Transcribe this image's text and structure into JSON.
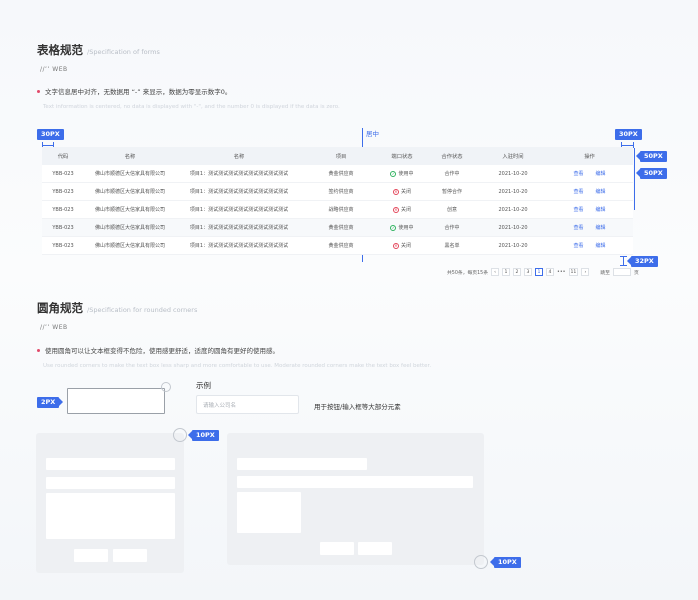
{
  "table_section": {
    "title": "表格规范",
    "subtitle": "/Specification of forms",
    "tag": "//’’  WEB",
    "rule_cn": "文字信息居中对齐，无数据用 “-” 来显示，数据为零显示数字0。",
    "rule_en": "Text information is centered, no data is displayed with \"-\", and the number 0 is displayed if the data is zero.",
    "center_label": "居中",
    "badges": {
      "left_margin": "30PX",
      "right_margin": "30PX",
      "row_height_1": "50PX",
      "row_height_2": "50PX",
      "bottom_gap": "32PX"
    },
    "columns": [
      "代码",
      "名称",
      "名称",
      "项目",
      "端口状态",
      "合作状态",
      "入驻时间",
      "操作"
    ],
    "rows": [
      {
        "code": "YBB-023",
        "company": "佛山市顺德区大信家具有限公司",
        "desc": "项目1：测试测试测试测试测试测试测试测试",
        "project": "黄金供应商",
        "status": "使用中",
        "coop": "合作中",
        "date": "2021-10-20",
        "op1": "查看",
        "op2": "编辑"
      },
      {
        "code": "YBB-023",
        "company": "佛山市顺德区大信家具有限公司",
        "desc": "项目1：测试测试测试测试测试测试测试测试",
        "project": "签约供应商",
        "status": "关闭",
        "coop": "暂停合作",
        "date": "2021-10-20",
        "op1": "查看",
        "op2": "编辑"
      },
      {
        "code": "YBB-023",
        "company": "佛山市顺德区大信家具有限公司",
        "desc": "项目1：测试测试测试测试测试测试测试测试",
        "project": "战略供应商",
        "status": "关闭",
        "coop": "创意",
        "date": "2021-10-20",
        "op1": "查看",
        "op2": "编辑"
      },
      {
        "code": "YBB-023",
        "company": "佛山市顺德区大信家具有限公司",
        "desc": "项目1：测试测试测试测试测试测试测试测试",
        "project": "黄金供应商",
        "status": "使用中",
        "coop": "合作中",
        "date": "2021-10-20",
        "op1": "查看",
        "op2": "编辑"
      },
      {
        "code": "YBB-023",
        "company": "佛山市顺德区大信家具有限公司",
        "desc": "项目1：测试测试测试测试测试测试测试测试",
        "project": "黄金供应商",
        "status": "关闭",
        "coop": "黑名单",
        "date": "2021-10-20",
        "op1": "查看",
        "op2": "编辑"
      }
    ],
    "pager": {
      "summary": "共50条，每页15条",
      "prev": "‹",
      "pages": [
        "1",
        "2",
        "3",
        "1",
        "4",
        "•••",
        "11"
      ],
      "active_index": 3,
      "next": "›",
      "jump_label": "跳至",
      "jump_suffix": "页"
    }
  },
  "radius_section": {
    "title": "圆角规范",
    "subtitle": "/Specification for rounded corners",
    "tag": "//’’  WEB",
    "rule_cn": "使用圆角可以让文本框变得不危险，使用感更舒适，适度的圆角有更好的使用感。",
    "rule_en": "Use rounded corners to make the text box less sharp and more comfortable to use. Moderate rounded corners make the text box feel better.",
    "badge_2px": "2PX",
    "badge_10px_a": "10PX",
    "badge_10px_b": "10PX",
    "example_label": "示例",
    "example_placeholder": "请输入公司名",
    "example_note": "用于按钮/输入框等大部分元素"
  },
  "colors": {
    "accent": "#3d6dea",
    "ok": "#2fb35f",
    "off": "#e3465a"
  }
}
